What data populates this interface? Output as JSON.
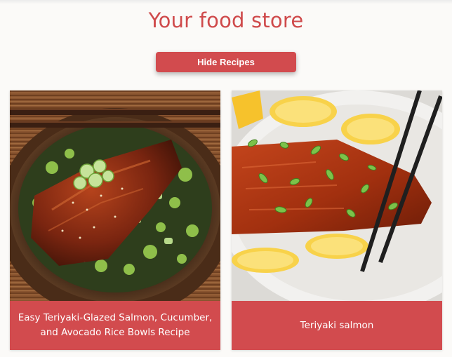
{
  "page": {
    "title": "Your food store"
  },
  "toolbar": {
    "hide_recipes_label": "Hide Recipes"
  },
  "recipes": [
    {
      "name": "Easy Teriyaki-Glazed Salmon, Cucumber, and Avocado Rice Bowls Recipe",
      "image": "salmon-rice-bowl-photo"
    },
    {
      "name": "Teriyaki salmon",
      "image": "teriyaki-salmon-plate-photo"
    }
  ],
  "colors": {
    "accent": "#d24b4e",
    "title": "#cf4a4b",
    "background": "#fbfaf8"
  }
}
